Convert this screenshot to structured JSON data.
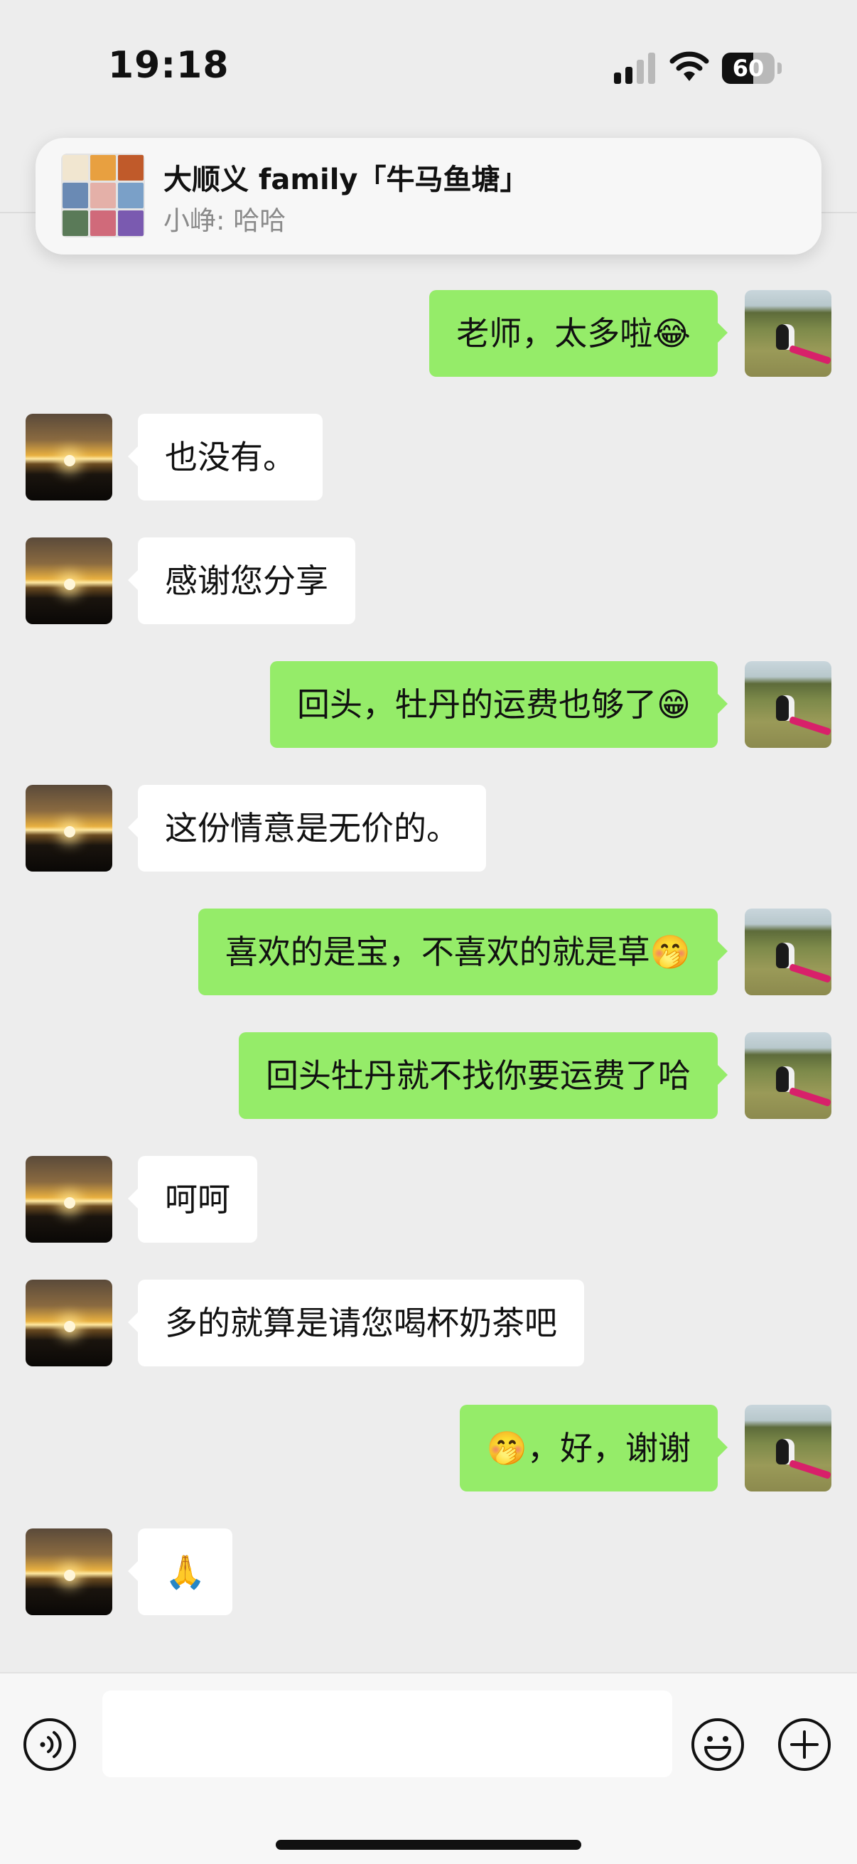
{
  "status_bar": {
    "time": "19:18",
    "battery_level": "60",
    "battery_fraction": 0.6
  },
  "notification": {
    "title": "大顺义 family「牛马鱼塘」",
    "sender": "小峥",
    "message": "哈哈",
    "preview": "小峥: 哈哈",
    "avatar_tiles": [
      "#f1e6d0",
      "#e8a040",
      "#c05a2a",
      "#6a8ab4",
      "#e4b0a8",
      "#7aa0c8",
      "#5a7a58",
      "#d06a7a",
      "#7a5ab0"
    ]
  },
  "messages": [
    {
      "side": "right",
      "text": "老师，太多啦😂",
      "avatar": "dog-photo"
    },
    {
      "side": "left",
      "text": "也没有。",
      "avatar": "sunset-photo"
    },
    {
      "side": "left",
      "text": "感谢您分享",
      "avatar": "sunset-photo"
    },
    {
      "side": "right",
      "text": "回头，牡丹的运费也够了😁",
      "avatar": "dog-photo"
    },
    {
      "side": "left",
      "text": "这份情意是无价的。",
      "avatar": "sunset-photo"
    },
    {
      "side": "right",
      "text": "喜欢的是宝，不喜欢的就是草🤭",
      "avatar": "dog-photo"
    },
    {
      "side": "right",
      "text": "回头牡丹就不找你要运费了哈",
      "avatar": "dog-photo"
    },
    {
      "side": "left",
      "text": "呵呵",
      "avatar": "sunset-photo"
    },
    {
      "side": "left",
      "text": "多的就算是请您喝杯奶茶吧",
      "avatar": "sunset-photo"
    },
    {
      "side": "right",
      "text": "🤭，好，谢谢",
      "avatar": "dog-photo"
    },
    {
      "side": "left",
      "text": "🙏",
      "avatar": "sunset-photo"
    }
  ],
  "input_bar": {
    "text_value": "",
    "icons": [
      "voice-icon",
      "emoji-icon",
      "plus-icon"
    ]
  },
  "colors": {
    "background": "#ededed",
    "sent_bubble": "#95ec69",
    "received_bubble": "#ffffff"
  }
}
